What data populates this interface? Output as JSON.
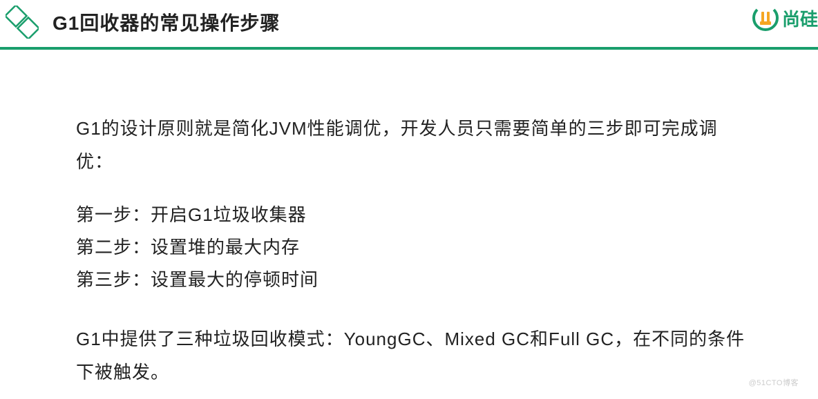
{
  "header": {
    "title": "G1回收器的常见操作步骤",
    "brand_text": "尚硅"
  },
  "content": {
    "intro": "G1的设计原则就是简化JVM性能调优，开发人员只需要简单的三步即可完成调优：",
    "steps": [
      "第一步：开启G1垃圾收集器",
      "第二步：设置堆的最大内存",
      "第三步：设置最大的停顿时间"
    ],
    "modes": "G1中提供了三种垃圾回收模式：YoungGC、Mixed GC和Full GC，在不同的条件下被触发。"
  },
  "watermark": "@51CTO博客"
}
